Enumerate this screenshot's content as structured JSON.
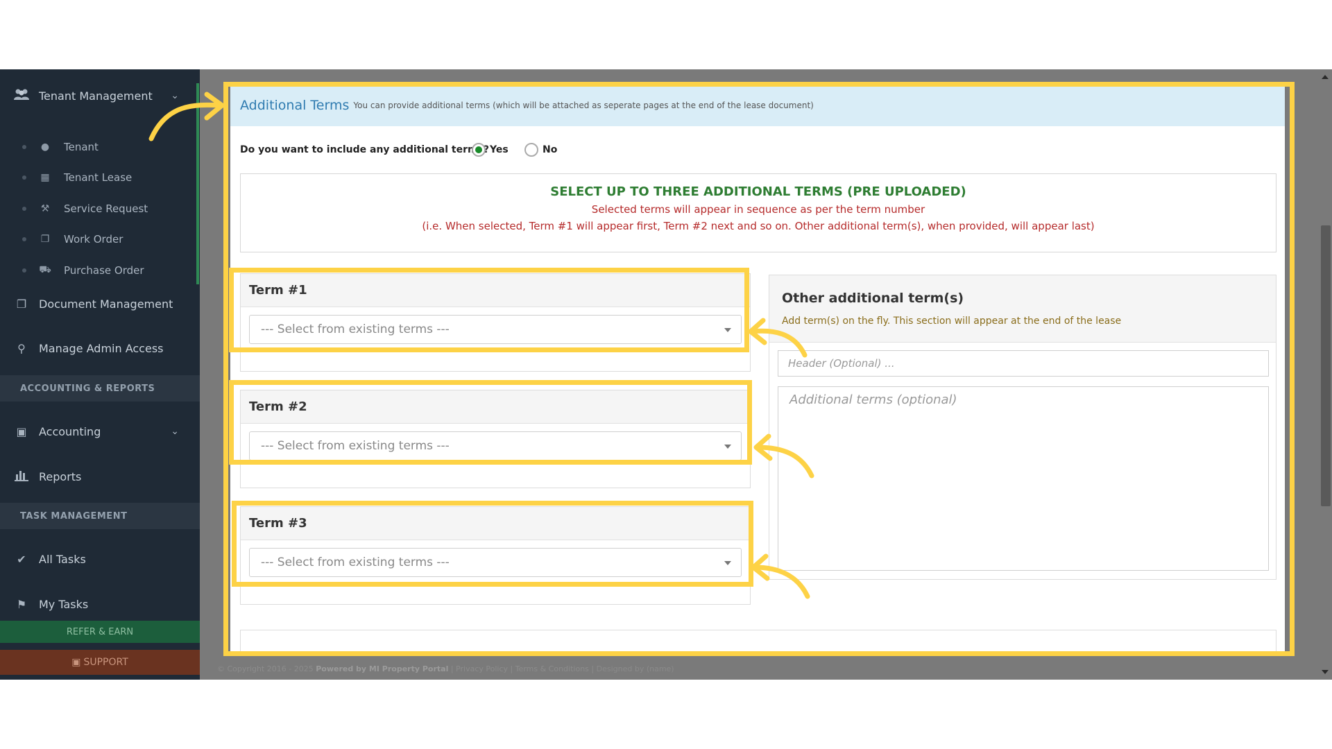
{
  "sidebar": {
    "items": [
      {
        "label": "Tenant Management",
        "icon": "users-icon"
      },
      {
        "label": "Document Management",
        "icon": "documents-icon"
      },
      {
        "label": "Manage Admin Access",
        "icon": "key-icon"
      },
      {
        "label": "Accounting",
        "icon": "money-icon"
      },
      {
        "label": "Reports",
        "icon": "bar-chart-icon"
      },
      {
        "label": "All Tasks",
        "icon": "check-icon"
      },
      {
        "label": "My Tasks",
        "icon": "tag-icon"
      }
    ],
    "sub_items": [
      {
        "label": "Tenant",
        "icon": "user-icon"
      },
      {
        "label": "Tenant Lease",
        "icon": "calendar-icon"
      },
      {
        "label": "Service Request",
        "icon": "wrench-icon"
      },
      {
        "label": "Work Order",
        "icon": "copy-icon"
      },
      {
        "label": "Purchase Order",
        "icon": "truck-icon"
      }
    ],
    "sections": [
      "ACCOUNTING & REPORTS",
      "TASK MANAGEMENT"
    ],
    "refer_label": "REFER & EARN",
    "support_label": "SUPPORT"
  },
  "panel": {
    "title": "Additional Terms",
    "subtitle": "You can provide additional terms (which will be attached as seperate pages at the end of the lease document)",
    "question": "Do you want to include any additional terms?",
    "yes_label": "Yes",
    "no_label": "No",
    "selected": "Yes",
    "select_box": {
      "heading": "SELECT UP TO THREE ADDITIONAL TERMS (PRE UPLOADED)",
      "line1": "Selected terms will appear in sequence as per the term number",
      "line2": "(i.e. When selected, Term #1 will appear first, Term #2 next and so on. Other additional term(s), when provided, will appear last)"
    },
    "terms": [
      {
        "label": "Term #1",
        "placeholder": "--- Select from existing terms ---"
      },
      {
        "label": "Term #2",
        "placeholder": "--- Select from existing terms ---"
      },
      {
        "label": "Term #3",
        "placeholder": "--- Select from existing terms ---"
      }
    ],
    "other": {
      "title": "Other additional term(s)",
      "subtitle": "Add term(s) on the fly. This section will appear at the end of the lease",
      "header_placeholder": "Header (Optional) ...",
      "body_placeholder": "Additional terms (optional)"
    }
  },
  "footer": {
    "copyright": "© Copyright 2016 - 2025",
    "powered": "Powered by MI Property Portal",
    "links": "| Privacy Policy | Terms & Conditions |",
    "extra": "Designed by (name)"
  },
  "colors": {
    "highlight": "#fdd246",
    "sidebar_bg": "#1f2a36",
    "panel_head_bg": "#d9edf7",
    "title_color": "#2f7bb0",
    "heading_green": "#2e7d32",
    "note_red": "#b52a2a"
  }
}
